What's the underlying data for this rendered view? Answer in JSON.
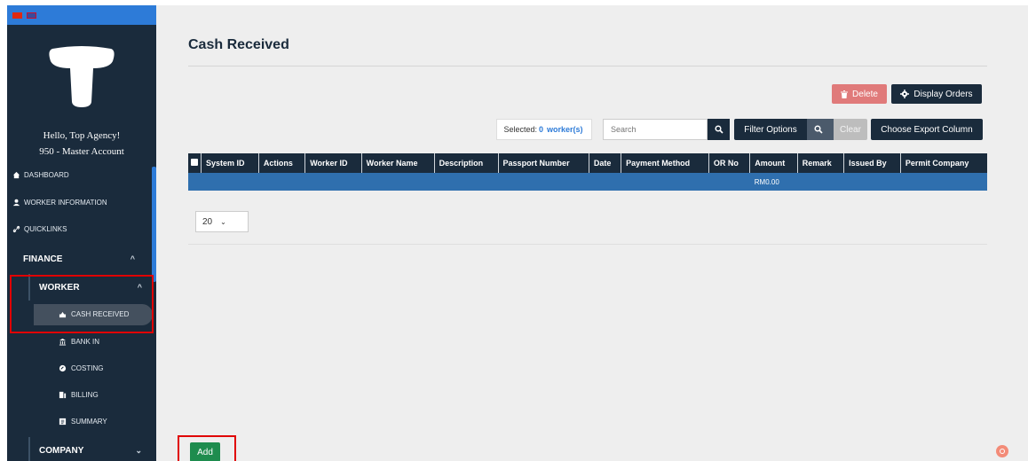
{
  "sidebar": {
    "greeting": "Hello, Top Agency!",
    "account": "950 - Master Account",
    "nav": [
      {
        "label": "DASHBOARD",
        "icon": "home-icon"
      },
      {
        "label": "WORKER INFORMATION",
        "icon": "user-icon"
      },
      {
        "label": "QUICKLINKS",
        "icon": "link-icon"
      }
    ],
    "finance": {
      "label": "FINANCE",
      "worker": {
        "label": "WORKER",
        "items": [
          {
            "label": "CASH RECEIVED",
            "icon": "cash-icon"
          },
          {
            "label": "BANK IN",
            "icon": "bank-icon"
          },
          {
            "label": "COSTING",
            "icon": "costing-icon"
          },
          {
            "label": "BILLING",
            "icon": "billing-icon"
          },
          {
            "label": "SUMMARY",
            "icon": "summary-icon"
          }
        ]
      },
      "company": {
        "label": "COMPANY"
      }
    }
  },
  "main": {
    "title": "Cash Received",
    "delete_label": "Delete",
    "display_orders_label": "Display Orders",
    "selected_prefix": "Selected:",
    "selected_count": "0",
    "selected_suffix": "worker(s)",
    "search_placeholder": "Search",
    "filter_label": "Filter Options",
    "clear_label": "Clear",
    "export_label": "Choose Export Column",
    "table": {
      "headers": [
        "System ID",
        "Actions",
        "Worker ID",
        "Worker Name",
        "Description",
        "Passport Number",
        "Date",
        "Payment Method",
        "OR No",
        "Amount",
        "Remark",
        "Issued By",
        "Permit Company"
      ],
      "total_amount": "RM0.00"
    },
    "page_size": "20",
    "add_label": "Add"
  },
  "colors": {
    "sidebar_bg": "#1a2b3c",
    "accent": "#2d7bd8",
    "delete": "#e07a7a",
    "add": "#1e8c4e",
    "highlight": "#e00000"
  }
}
